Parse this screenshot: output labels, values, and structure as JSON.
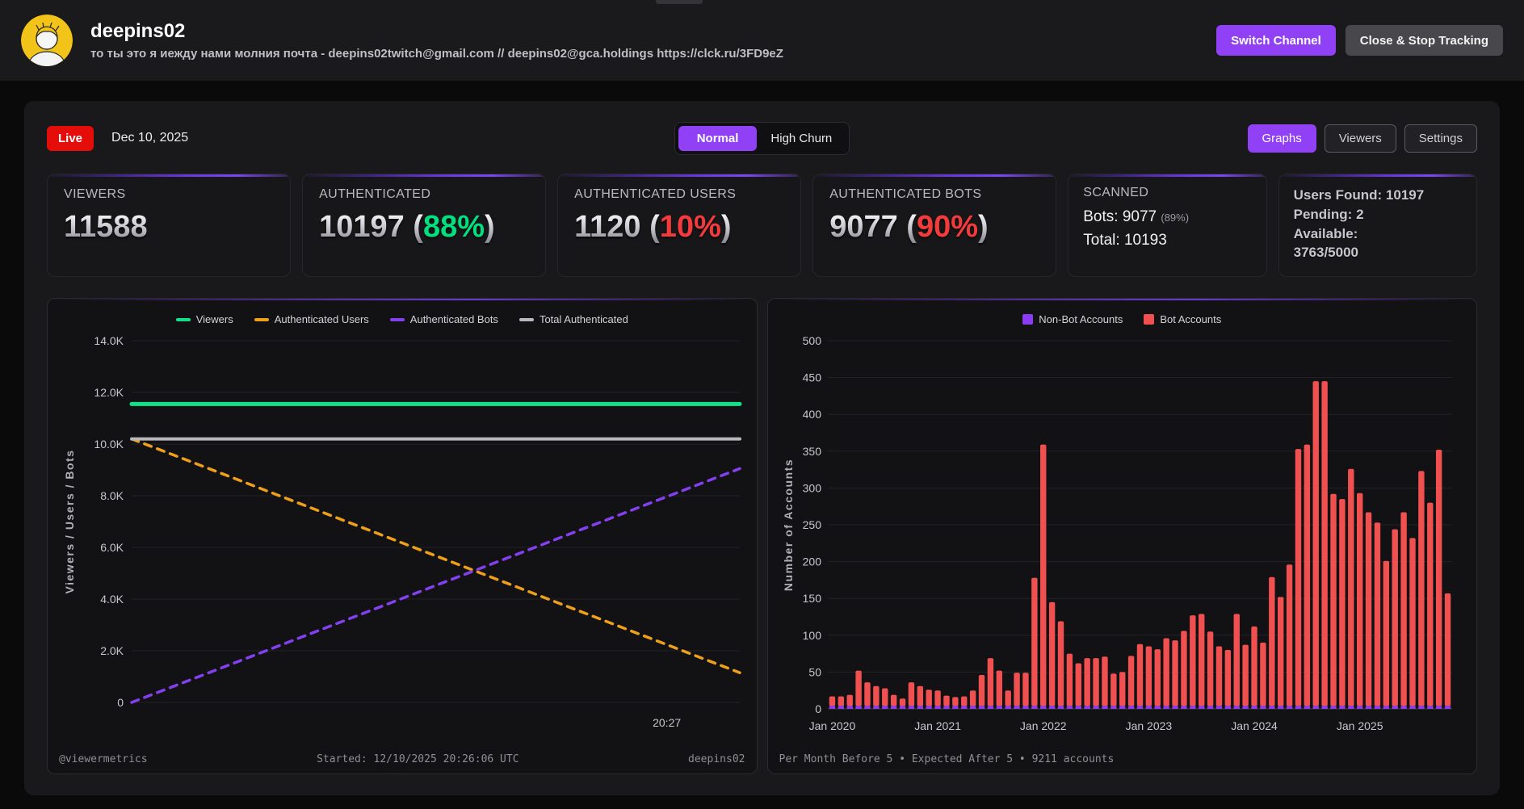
{
  "header": {
    "title": "deepins02",
    "subtitle": "то ты это я иежду нами молния почта - deepins02twitch@gmail.com // deepins02@gca.holdings https://clck.ru/3FD9eZ",
    "switch_channel_label": "Switch Channel",
    "close_stop_label": "Close & Stop Tracking"
  },
  "controls": {
    "live_label": "Live",
    "date": "Dec 10, 2025",
    "mode_toggle": {
      "options": [
        "Normal",
        "High Churn"
      ],
      "selected": "Normal"
    },
    "view_buttons": {
      "options": [
        "Graphs",
        "Viewers",
        "Settings"
      ],
      "selected": "Graphs"
    }
  },
  "stats_meta": {
    "percent_open": " (",
    "percent_close": ")"
  },
  "stats": [
    {
      "label": "VIEWERS",
      "value": "11588",
      "pct": "",
      "pct_color": ""
    },
    {
      "label": "AUTHENTICATED",
      "value": "10197",
      "pct": "88%",
      "pct_color": "#00e07f"
    },
    {
      "label": "AUTHENTICATED USERS",
      "value": "1120",
      "pct": "10%",
      "pct_color": "#f43b3b"
    },
    {
      "label": "AUTHENTICATED BOTS",
      "value": "9077",
      "pct": "90%",
      "pct_color": "#f43b3b"
    }
  ],
  "scanned_card": {
    "label": "SCANNED",
    "bots_line": "Bots: 9077",
    "bots_percent": "(89%)",
    "total_line": "Total: 10193"
  },
  "quota_card": {
    "lines": [
      "Users Found: 10197",
      "Pending: 2",
      "Available:",
      "3763/5000"
    ]
  },
  "colors": {
    "accent_purple": "#9040f5",
    "live_red": "#e50d0a",
    "green": "#00e07f",
    "red": "#f43b3b",
    "grid": "#232329"
  },
  "chart_data": [
    {
      "type": "line",
      "title": "",
      "ylabel": "Viewers / Users / Bots",
      "ylim": [
        0,
        14000
      ],
      "yticks": [
        {
          "v": 0,
          "l": "0"
        },
        {
          "v": 2000,
          "l": "2.0K"
        },
        {
          "v": 4000,
          "l": "4.0K"
        },
        {
          "v": 6000,
          "l": "6.0K"
        },
        {
          "v": 8000,
          "l": "8.0K"
        },
        {
          "v": 10000,
          "l": "10.0K"
        },
        {
          "v": 12000,
          "l": "12.0K"
        },
        {
          "v": 14000,
          "l": "14.0K"
        }
      ],
      "xticks": [
        {
          "pos": 0.88,
          "label": "20:27"
        }
      ],
      "grid": true,
      "legend_position": "top",
      "series": [
        {
          "name": "Viewers",
          "color": "#12e287",
          "dash": false,
          "width": 5,
          "points": [
            [
              0,
              11550
            ],
            [
              1,
              11550
            ]
          ]
        },
        {
          "name": "Authenticated Users",
          "color": "#efa018",
          "dash": true,
          "width": 3.5,
          "points": [
            [
              0,
              10200
            ],
            [
              1,
              1150
            ]
          ]
        },
        {
          "name": "Authenticated Bots",
          "color": "#8440f0",
          "dash": true,
          "width": 3.5,
          "points": [
            [
              0,
              0
            ],
            [
              1,
              9050
            ]
          ]
        },
        {
          "name": "Total Authenticated",
          "color": "#b8b8bd",
          "dash": false,
          "width": 4,
          "points": [
            [
              0,
              10200
            ],
            [
              1,
              10200
            ]
          ]
        }
      ],
      "footer_left": "@viewermetrics",
      "footer_center": "Started: 12/10/2025 20:26:06 UTC",
      "footer_right": "deepins02"
    },
    {
      "type": "bar",
      "title": "",
      "ylabel": "Number of Accounts",
      "ylim": [
        0,
        500
      ],
      "ytick_step": 50,
      "grid": true,
      "legend_position": "top",
      "stacked": true,
      "xticks": [
        {
          "index": 0,
          "label": "Jan 2020"
        },
        {
          "index": 12,
          "label": "Jan 2021"
        },
        {
          "index": 24,
          "label": "Jan 2022"
        },
        {
          "index": 36,
          "label": "Jan 2023"
        },
        {
          "index": 48,
          "label": "Jan 2024"
        },
        {
          "index": 60,
          "label": "Jan 2025"
        }
      ],
      "series": [
        {
          "name": "Non-Bot Accounts",
          "color": "#8b3bf2",
          "values": [
            4,
            4,
            4,
            4,
            4,
            4,
            4,
            4,
            4,
            4,
            4,
            4,
            4,
            4,
            4,
            4,
            4,
            4,
            4,
            4,
            4,
            4,
            4,
            4,
            4,
            4,
            4,
            4,
            4,
            4,
            4,
            4,
            4,
            4,
            4,
            4,
            4,
            4,
            4,
            4,
            4,
            4,
            4,
            4,
            4,
            4,
            4,
            4,
            4,
            4,
            4,
            4,
            4,
            4,
            4,
            4,
            4,
            4,
            4,
            4,
            4,
            4,
            4,
            4,
            4,
            4,
            4,
            4,
            4,
            4,
            4
          ]
        },
        {
          "name": "Bot Accounts",
          "color": "#f15050",
          "values": [
            13,
            13,
            15,
            48,
            32,
            27,
            24,
            15,
            10,
            32,
            27,
            22,
            21,
            14,
            12,
            13,
            21,
            42,
            65,
            48,
            21,
            45,
            45,
            174,
            355,
            141,
            115,
            71,
            58,
            65,
            65,
            67,
            44,
            46,
            68,
            84,
            81,
            77,
            92,
            89,
            102,
            123,
            125,
            101,
            81,
            76,
            125,
            83,
            108,
            86,
            175,
            148,
            192,
            349,
            355,
            441,
            441,
            288,
            281,
            322,
            289,
            263,
            249,
            197,
            240,
            263,
            228,
            319,
            276,
            348,
            153
          ]
        }
      ],
      "footer": "Per Month Before 5 • Expected After 5 • 9211 accounts"
    }
  ]
}
